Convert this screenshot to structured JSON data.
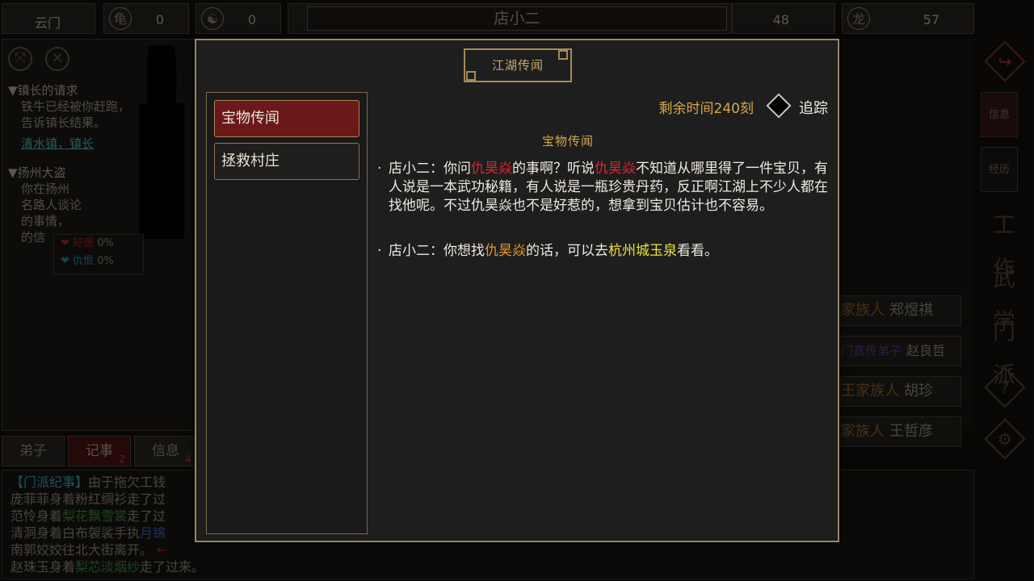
{
  "topbar": {
    "cells": [
      {
        "label": "云门"
      },
      {
        "icon": "tortoise-icon",
        "value": "0"
      },
      {
        "icon": "yin-yang-icon",
        "value": "0"
      },
      {
        "value": "48"
      },
      {
        "icon": "dragon-icon",
        "value": "57"
      }
    ],
    "title": "店小二"
  },
  "background": {
    "quests": [
      {
        "title": "▼镇长的请求",
        "lines": [
          "铁牛已经被你赶跑，",
          "告诉镇长结果。"
        ],
        "link": "清水镇，镇长"
      },
      {
        "title": "▼扬州大盗",
        "lines": [
          "你在扬州",
          "名路人谈论",
          "的事情，",
          "的信"
        ]
      }
    ],
    "favor": {
      "like_label": "好感",
      "like_value": "0%",
      "hate_label": "仇恨",
      "hate_value": "0%"
    },
    "tabs": [
      {
        "label": "弟子",
        "count": ""
      },
      {
        "label": "记事",
        "count": "2"
      },
      {
        "label": "信息",
        "count": "4"
      }
    ],
    "log": {
      "line1_tag": "【门派纪事】",
      "line1": "由于拖欠工钱",
      "line2": "庞菲菲身着粉红绸衫走了过",
      "line3_a": "范怜身着",
      "line3_item": "梨花飘雪裳",
      "line3_b": "走了过",
      "line4_a": "清洞身着白布袈裟手执",
      "line4_item": "月锦",
      "line5": "南郭姣姣往北大街离开。",
      "line6_a": "赵珠玉身着",
      "line6_item": "梨芯淡烟纱",
      "line6_b": "走了过来。"
    },
    "members": [
      {
        "rank": "家族人",
        "name": "郑煜祺"
      },
      {
        "rank": "门真传弟子",
        "name": "赵良哲"
      },
      {
        "rank": "王家族人",
        "name": "胡珍"
      },
      {
        "rank": "家族人",
        "name": "王哲彦"
      }
    ],
    "side_buttons": [
      "信息",
      "经历"
    ],
    "side_glyphs": [
      "工作",
      "武学",
      "门派"
    ]
  },
  "modal": {
    "title": "江湖传闻",
    "list": [
      "宝物传闻",
      "拯救村庄"
    ],
    "timer": "剩余时间240刻",
    "track_label": "追踪",
    "section_title": "宝物传闻",
    "entry1": {
      "speaker": "店小二：",
      "t1": "你问",
      "name1": "仇昊焱",
      "t2": "的事啊？听说",
      "name2": "仇昊焱",
      "t3": "不知道从哪里得了一件宝贝，有人说是一本武功秘籍，有人说是一瓶珍贵丹药，反正啊江湖上不少人都在找他呢。不过仇昊焱也不是好惹的，想拿到宝贝估计也不容易。"
    },
    "entry2": {
      "speaker": "店小二：",
      "t1": "你想找",
      "name": "仇昊焱",
      "t2": "的话，可以去",
      "place": "杭州城玉泉",
      "t3": "看看。"
    }
  },
  "colors": {
    "accent": "#d6a84a",
    "selected": "#6b1818",
    "highlight_red": "#e0242a",
    "highlight_orange": "#e8962c",
    "highlight_yellow": "#e8e43a"
  }
}
